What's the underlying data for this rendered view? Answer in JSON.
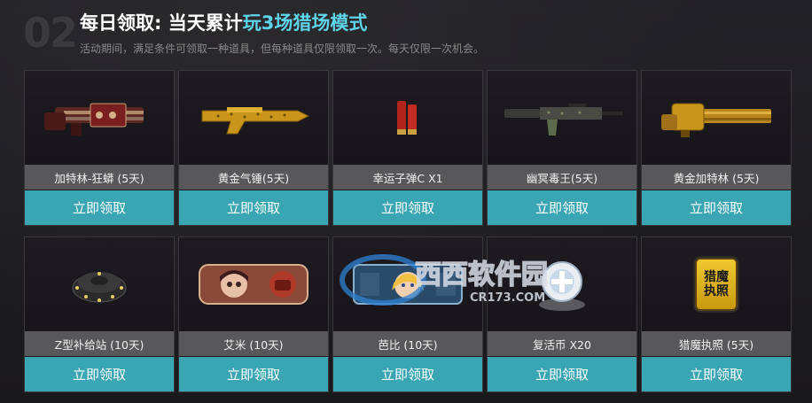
{
  "header": {
    "step_number": "02",
    "title_prefix": "每日领取: 当天累计",
    "title_highlight": "玩3场猎场模式",
    "subtitle": "活动期间，满足条件可领取一种道具，但每种道具仅限领取一次。每天仅限一次机会。"
  },
  "items": [
    {
      "name": "加特林-狂蟒 (5天)",
      "button": "立即领取",
      "icon": "gatling-gun-icon"
    },
    {
      "name": "黄金气锤(5天)",
      "button": "立即领取",
      "icon": "golden-rifle-icon"
    },
    {
      "name": "幸运子弹C X1",
      "button": "立即领取",
      "icon": "bullet-icon"
    },
    {
      "name": "幽冥毒王(5天)",
      "button": "立即领取",
      "icon": "assault-rifle-icon"
    },
    {
      "name": "黄金加特林 (5天)",
      "button": "立即领取",
      "icon": "golden-gatling-icon"
    },
    {
      "name": "Z型补给站 (10天)",
      "button": "立即领取",
      "icon": "supply-station-icon"
    },
    {
      "name": "艾米 (10天)",
      "button": "立即领取",
      "icon": "character-amy-icon"
    },
    {
      "name": "芭比 (10天)",
      "button": "立即领取",
      "icon": "character-barbie-icon"
    },
    {
      "name": "复活币 X20",
      "button": "立即领取",
      "icon": "revive-coin-icon"
    },
    {
      "name": "猎魔执照 (5天)",
      "button": "立即领取",
      "icon": "hunter-license-icon",
      "icon_text": "猎魔\n执照"
    }
  ],
  "watermark": {
    "text": "西西软件园",
    "sub": "CR173.COM"
  },
  "colors": {
    "accent": "#3aa6b3",
    "highlight": "#5fd4e9",
    "name_bar": "#58585a"
  }
}
